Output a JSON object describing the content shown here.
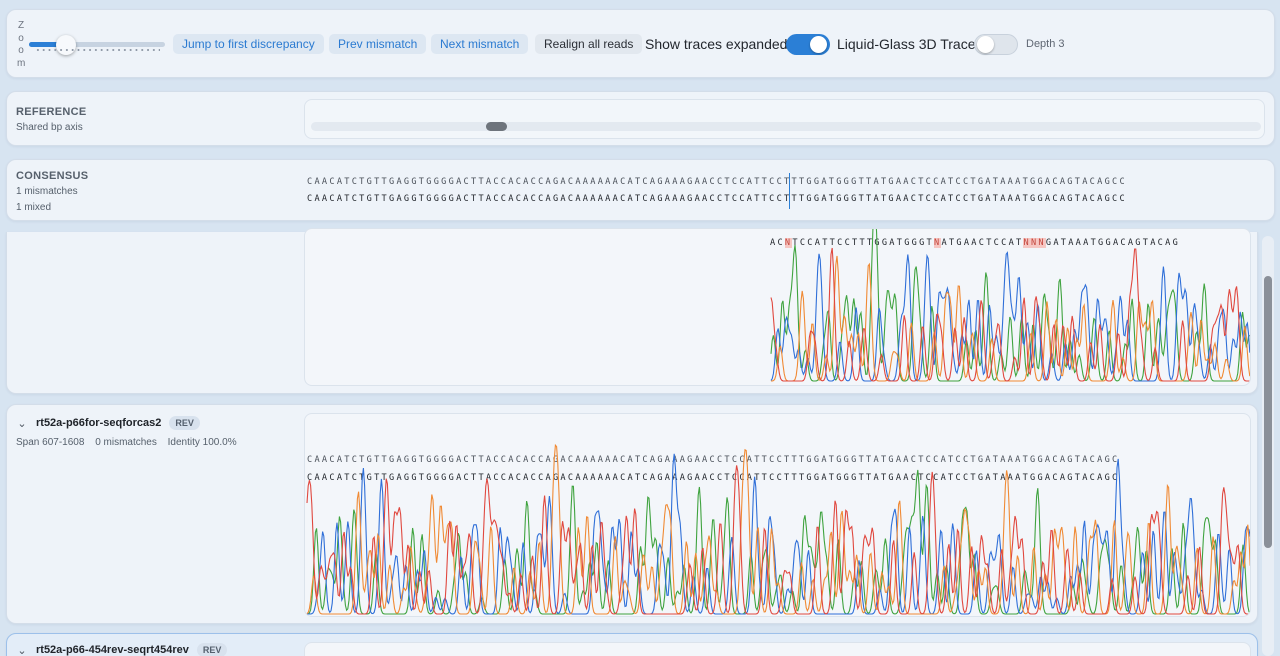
{
  "toolbar": {
    "zoom_label": "Zoom",
    "zoom_level": 0.27,
    "buttons": {
      "jump": "Jump to first discrepancy",
      "prev": "Prev mismatch",
      "next": "Next mismatch",
      "realign": "Realign all reads"
    },
    "show_traces_label": "Show traces expanded",
    "show_traces_on": true,
    "liquid_glass_label": "Liquid-Glass 3D Trace",
    "liquid_glass_on": false,
    "depth_label": "Depth 3"
  },
  "reference": {
    "title": "REFERENCE",
    "subtitle": "Shared bp axis"
  },
  "consensus": {
    "title": "CONSENSUS",
    "mismatches": "1 mismatches",
    "mixed": "1 mixed",
    "ref_seq": "CAACATCTGTTGAGGTGGGGACTTACCACACCAGACAAAAAACATCAGAAAGAACCTCCATTCCTTTGGATGGGTTATGAACTCCATCCTGATAAATGGACAGTACAGCC",
    "cons_seq": "CAACATCTGTTGAGGTGGGGACTTACCACACCAGACAAAAAACATCAGAAAGAACCTCCATTCCTTTGGATGGGTTATGAACTCCATCCTGATAAATGGACAGTACAGCC"
  },
  "read1": {
    "seq_parts": [
      "AC",
      "N",
      "TCCATTCCTTTGGATGGGT",
      "N",
      "ATGAACTCCAT",
      "NNN",
      "GATAAATGGACAGTACAG"
    ]
  },
  "read2": {
    "name": "rt52a-p66for-seqforcas2",
    "badge": "REV",
    "span": "Span 607-1608",
    "mismatches": "0 mismatches",
    "identity": "Identity 100.0%",
    "ref_seq": "CAACATCTGTTGAGGTGGGGACTTACCACACCAGACAAAAAACATCAGAAAGAACCTCCATTCCTTTGGATGGGTTATGAACTCCATCCTGATAAATGGACAGTACAGC",
    "read_seq": "CAACATCTGTTGAGGTGGGGACTTACCACACCAGACAAAAAACATCAGAAAGAACCTCCATTCCTTTGGATGGGTTATGAACTCCATCCTGATAAATGGACAGTACAGC"
  },
  "read3": {
    "name": "rt52a-p66-454rev-seqrt454rev",
    "badge": "REV"
  },
  "colors": {
    "A": "#3fa33f",
    "C": "#2f6fd8",
    "G": "#f08a34",
    "T": "#e0483f",
    "accent": "#2b7fd6"
  }
}
